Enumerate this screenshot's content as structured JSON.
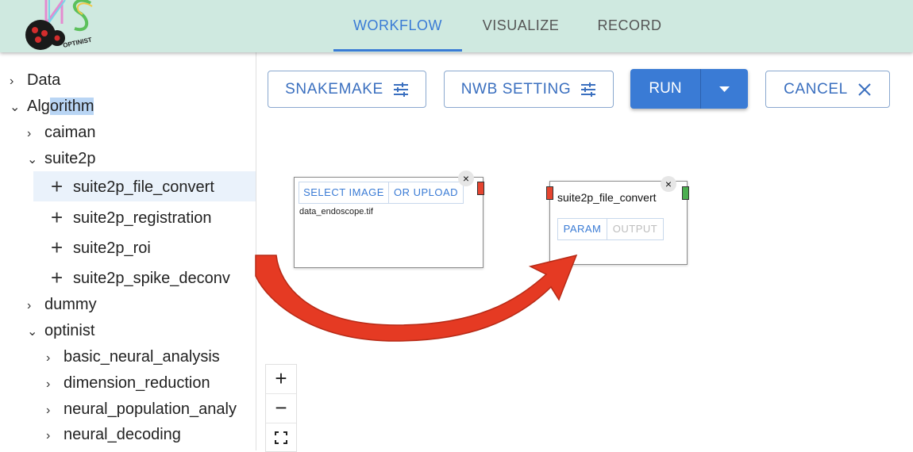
{
  "header": {
    "logo_text": "OPTINIST",
    "tabs": [
      {
        "label": "WORKFLOW",
        "active": true
      },
      {
        "label": "VISUALIZE",
        "active": false
      },
      {
        "label": "RECORD",
        "active": false
      }
    ],
    "accent_color": "#3a7bd5",
    "background_color": "#cfe9e0"
  },
  "sidebar": {
    "data": "Data",
    "algorithm_prefix": "Alg",
    "algorithm_highlight": "orithm",
    "caiman": "caiman",
    "suite2p": "suite2p",
    "suite2p_items": [
      "suite2p_file_convert",
      "suite2p_registration",
      "suite2p_roi",
      "suite2p_spike_deconv"
    ],
    "dummy": "dummy",
    "optinist": "optinist",
    "optinist_items": [
      "basic_neural_analysis",
      "dimension_reduction",
      "neural_population_analy",
      "neural_decoding"
    ]
  },
  "toolbar": {
    "snakemake": "SNAKEMAKE",
    "nwb_setting": "NWB SETTING",
    "run": "RUN",
    "cancel": "CANCEL"
  },
  "image_node": {
    "select_image": "SELECT IMAGE",
    "or_upload": "OR UPLOAD",
    "file_name": "data_endoscope.tif",
    "close": "×"
  },
  "algo_node": {
    "title": "suite2p_file_convert",
    "param": "PARAM",
    "output": "OUTPUT",
    "close": "×"
  },
  "zoom": {
    "zoom_in": "+",
    "zoom_out": "−"
  },
  "colors": {
    "arrow_red": "#e53a23",
    "handle_red": "#e5442f",
    "handle_green": "#4caf50"
  }
}
